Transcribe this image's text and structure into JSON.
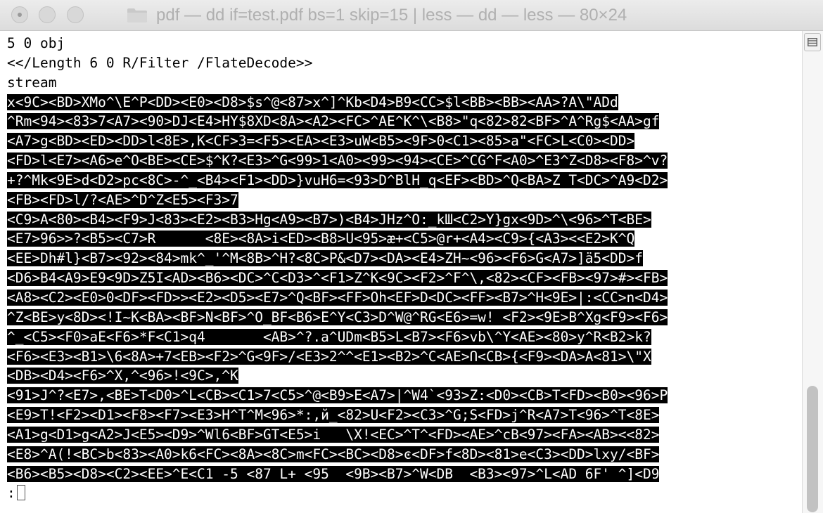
{
  "window": {
    "title": "pdf — dd if=test.pdf bs=1 skip=15 | less — dd — less — 80×24",
    "icon": "folder-icon",
    "buttons": [
      "close",
      "minimize",
      "zoom"
    ]
  },
  "terminal": {
    "prompt": ":",
    "lines": [
      "5 0 obj",
      "<</Length 6 0 R/Filter /FlateDecode>>",
      "stream",
      "x<9C><BD>XMo^\\E^P<DD><E0><D8>$s^@<87>x^]^Kb<D4>B9<CC>$l<BB><BB><AA>?A\\\"ADd",
      "^Rm<94><83>7<A7><90>DJ<E4>HY$8XD<8A><A2><FC>^AE^K^\\<B8>\"q<82>82<BF>^A^Rg$<AA>gf",
      "<A7>g<BD><ED><DD>l<8E>,K<CF>3=<F5><EA><E3>uW<B5><9F>0<C1><85>a\"<FC>L<C0><DD>",
      "<FD>l<E7><A6>e^O<BE><CE>$^K?<E3>^G<99>1<A0><99><94><CE>^CG^F<A0>^E3^Z<D8><F8>^v?",
      "+?^Mk<9E>d<D2>pc<8C>-^_<B4><F1><DD>}vuH6=<93>D^BlH_q<EF><BD>^Q<BA>Z T<DC>^A9<D2>",
      "<FB><FD>l/?<AE>^D^Z<E5><F3>7",
      "<C9>A<80><B4><F9>J<83><E2><B3>Hg<A9><B7>)<B4>JHz^O:_kШ<C2>Y}gx<9D>^\\<96>^T<BE>",
      "<E7>96>>?<B5><C7>R      <8E><8A>i<ED><B8>U<95>æ+<C5>@r+<A4><C9>{<A3><<E2>K^Q",
      "<EE>Dh#l}<B7><92><84>mk^_'^M<8B>^H?<8C>P&<D7><DA><E4>ZH~<96><F6>G<A7>]ä5<DD>f",
      "<D6>B4<A9>E9<9D>Z5I<AD><B6><DC>^C<D3>^<F1>Z^K<9C><F2>^F^\\,<82><CF><FB><97>#><FB>",
      "<A8><C2><E0>0<DF><FD>><E2><D5><E7>^Q<BF><FF>Oh<EF>D<DC><FF><B7>^H<9E>|:<CC>n<D4>",
      "^Z<BE>y<8D><!I~K<BA><BF>N<BF>^O_BF<B6>E^Y<C3>D^W@^RG<E6>=w! <F2><9E>B^Xg<F9><F6>",
      "^_<C5><F0>aE<F6>*F<C1>q4       <AB>^?.a^UDm<B5>L<B7><F6>vb\\^Y<AE><80>y^R<B2>k?",
      "<F6><E3><B1>\\6<8A>+7<EB><F2>^G<9F>/<E3>2^^<E1><B2>^C<AE>Ո<CB>{<F9><DA>A<81>\\\"X",
      "<DB><D4><F6>^X,^<96>!<9C>,^K",
      "<91>J^?<E7>,<BE>T<D0>^L<CB><C1>7<C5>^@<B9>E<A7>|^W4`<93>Z:<D0><CB>T<FD><B0><96>P",
      "<E9>T!<F2><D1><F8><F7><E3>H^T^M<96>*:,й_<82>U<F2><C3>^G;S<FD>j^R<A7>T<96>^T<8E>",
      "<A1>g<D1>g<A2>J<E5><D9>^Wl6<BF>GT<E5>i   \\X!<EC>^T^<FD><AE>^cB<97><FA><AB><<82>",
      "<E8>^A(!<BC>b<83><A0>k6<FC><8A><8C>m<FC><BC><D8>ͼ<DF>f<8D><81>e<C3><DD>lxy/<BF>",
      "<B6><B5><D8><C2><EE>^E<C1 -5 <87 L+ <95  <9B><B7>^W<DB  <B3><97>^L<AD 6F' ^]<D9"
    ]
  }
}
